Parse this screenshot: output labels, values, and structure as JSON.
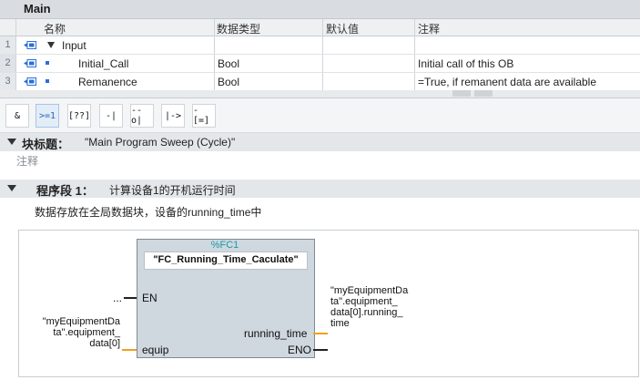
{
  "window": {
    "title": "Main"
  },
  "interface": {
    "columns": [
      "名称",
      "数据类型",
      "默认值",
      "注释"
    ],
    "rows": [
      {
        "num": "1",
        "name": "Input",
        "type": "",
        "default": "",
        "comment": ""
      },
      {
        "num": "2",
        "name": "Initial_Call",
        "type": "Bool",
        "default": "",
        "comment": "Initial call of this OB"
      },
      {
        "num": "3",
        "name": "Remanence",
        "type": "Bool",
        "default": "",
        "comment": "=True, if remanent data are available"
      }
    ]
  },
  "toolbar": {
    "buttons": [
      "&",
      ">=1",
      "[??]",
      "-|",
      "--o|",
      "|->",
      "-[=]"
    ]
  },
  "block": {
    "title_label": "块标题：",
    "title_value": "\"Main Program Sweep (Cycle)\"",
    "comment": "注释"
  },
  "network": {
    "label": "程序段 1：",
    "title": "计算设备1的开机运行时间",
    "comment": "数据存放在全局数据块，设备的running_time中"
  },
  "fc": {
    "instance": "%FC1",
    "name": "\"FC_Running_Time_Caculate\"",
    "pins": {
      "en": "EN",
      "equip": "equip",
      "running_time": "running_time",
      "eno": "ENO"
    },
    "en_input": "...",
    "equip_input": "\"myEquipmentDa\nta\".equipment_\ndata[0]",
    "running_time_output": "\"myEquipmentDa\nta\".equipment_\ndata[0].running_\ntime"
  },
  "colors": {
    "wire_param": "#f0a020",
    "instance": "#1a9aa8",
    "accent": "#2a6fd6"
  }
}
